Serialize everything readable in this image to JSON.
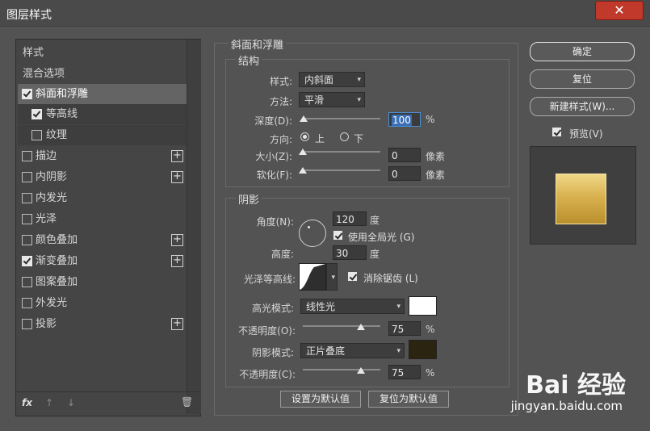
{
  "window": {
    "title": "图层样式",
    "close": "✕"
  },
  "sidebar": {
    "items": [
      {
        "label": "样式"
      },
      {
        "label": "混合选项"
      },
      {
        "label": "斜面和浮雕",
        "checked": true
      },
      {
        "label": "等高线",
        "checked": true
      },
      {
        "label": "纹理",
        "checked": false
      },
      {
        "label": "描边",
        "checked": false,
        "plus": "+"
      },
      {
        "label": "内阴影",
        "checked": false,
        "plus": "+"
      },
      {
        "label": "内发光",
        "checked": false
      },
      {
        "label": "光泽",
        "checked": false
      },
      {
        "label": "颜色叠加",
        "checked": false,
        "plus": "+"
      },
      {
        "label": "渐变叠加",
        "checked": true,
        "plus": "+"
      },
      {
        "label": "图案叠加",
        "checked": false
      },
      {
        "label": "外发光",
        "checked": false
      },
      {
        "label": "投影",
        "checked": false,
        "plus": "+"
      }
    ],
    "footer": {
      "fx": "fx",
      "up": "↑",
      "down": "↓",
      "trash": "🗑"
    }
  },
  "bevel": {
    "title": "斜面和浮雕",
    "structure": {
      "title": "结构",
      "style_label": "样式:",
      "style_value": "内斜面",
      "method_label": "方法:",
      "method_value": "平滑",
      "depth_label": "深度(D):",
      "depth_value": "100",
      "depth_unit": "%",
      "depth_level": 0.01,
      "direction_label": "方向:",
      "dir_up": "上",
      "dir_down": "下",
      "size_label": "大小(Z):",
      "size_value": "0",
      "size_unit": "像素",
      "soften_label": "软化(F):",
      "soften_value": "0",
      "soften_unit": "像素"
    },
    "shading": {
      "title": "阴影",
      "angle_label": "角度(N):",
      "angle_value": "120",
      "angle_unit": "度",
      "global_light": "使用全局光 (G)",
      "altitude_label": "高度:",
      "altitude_value": "30",
      "altitude_unit": "度",
      "gloss_label": "光泽等高线:",
      "antialias": "消除锯齿 (L)",
      "highlight_label": "高光模式:",
      "highlight_value": "线性光",
      "highlight_color": "#ffffff",
      "opacity1_label": "不透明度(O):",
      "opacity1_value": "75",
      "opacity1_unit": "%",
      "shadow_label": "阴影模式:",
      "shadow_value": "正片叠底",
      "shadow_color": "#2a2410",
      "opacity2_label": "不透明度(C):",
      "opacity2_value": "75",
      "opacity2_unit": "%"
    },
    "buttons": {
      "set_default": "设置为默认值",
      "reset_default": "复位为默认值"
    }
  },
  "right": {
    "ok": "确定",
    "reset": "复位",
    "new_style": "新建样式(W)...",
    "preview": "预览(V)"
  },
  "watermark": {
    "brand": "Bai 经验",
    "url": "jingyan.baidu.com"
  }
}
